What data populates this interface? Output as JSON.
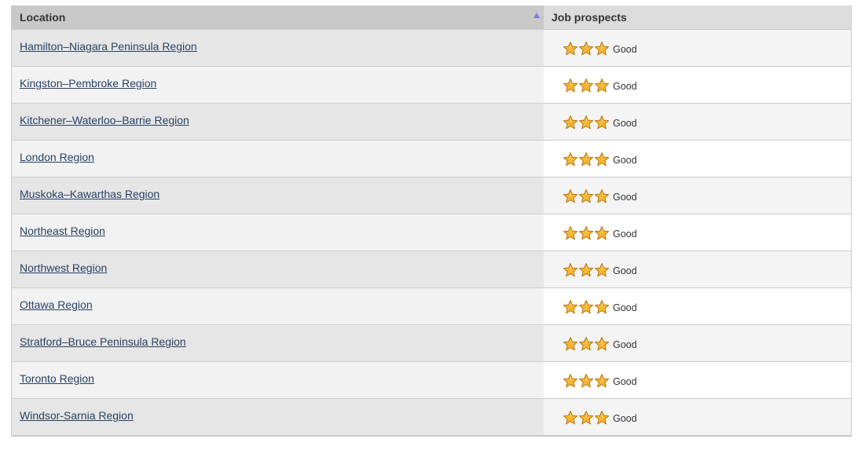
{
  "table": {
    "headers": {
      "location": "Location",
      "job_prospects": "Job prospects"
    },
    "sort": {
      "column": "location",
      "direction": "ascending",
      "indicator_color": "#7b7fd6"
    },
    "rows": [
      {
        "location": "Hamilton–Niagara Peninsula Region",
        "stars": 3,
        "max_stars": 3,
        "rating": "Good"
      },
      {
        "location": "Kingston–Pembroke Region",
        "stars": 3,
        "max_stars": 3,
        "rating": "Good"
      },
      {
        "location": "Kitchener–Waterloo–Barrie Region",
        "stars": 3,
        "max_stars": 3,
        "rating": "Good"
      },
      {
        "location": "London Region",
        "stars": 3,
        "max_stars": 3,
        "rating": "Good"
      },
      {
        "location": "Muskoka–Kawarthas Region",
        "stars": 3,
        "max_stars": 3,
        "rating": "Good"
      },
      {
        "location": "Northeast Region",
        "stars": 3,
        "max_stars": 3,
        "rating": "Good"
      },
      {
        "location": "Northwest Region",
        "stars": 3,
        "max_stars": 3,
        "rating": "Good"
      },
      {
        "location": "Ottawa Region",
        "stars": 3,
        "max_stars": 3,
        "rating": "Good"
      },
      {
        "location": "Stratford–Bruce Peninsula Region",
        "stars": 3,
        "max_stars": 3,
        "rating": "Good"
      },
      {
        "location": "Toronto Region",
        "stars": 3,
        "max_stars": 3,
        "rating": "Good"
      },
      {
        "location": "Windsor-Sarnia Region",
        "stars": 3,
        "max_stars": 3,
        "rating": "Good"
      }
    ]
  },
  "colors": {
    "link": "#284162",
    "star_fill": "#f7b733",
    "star_stroke": "#b8770f"
  }
}
